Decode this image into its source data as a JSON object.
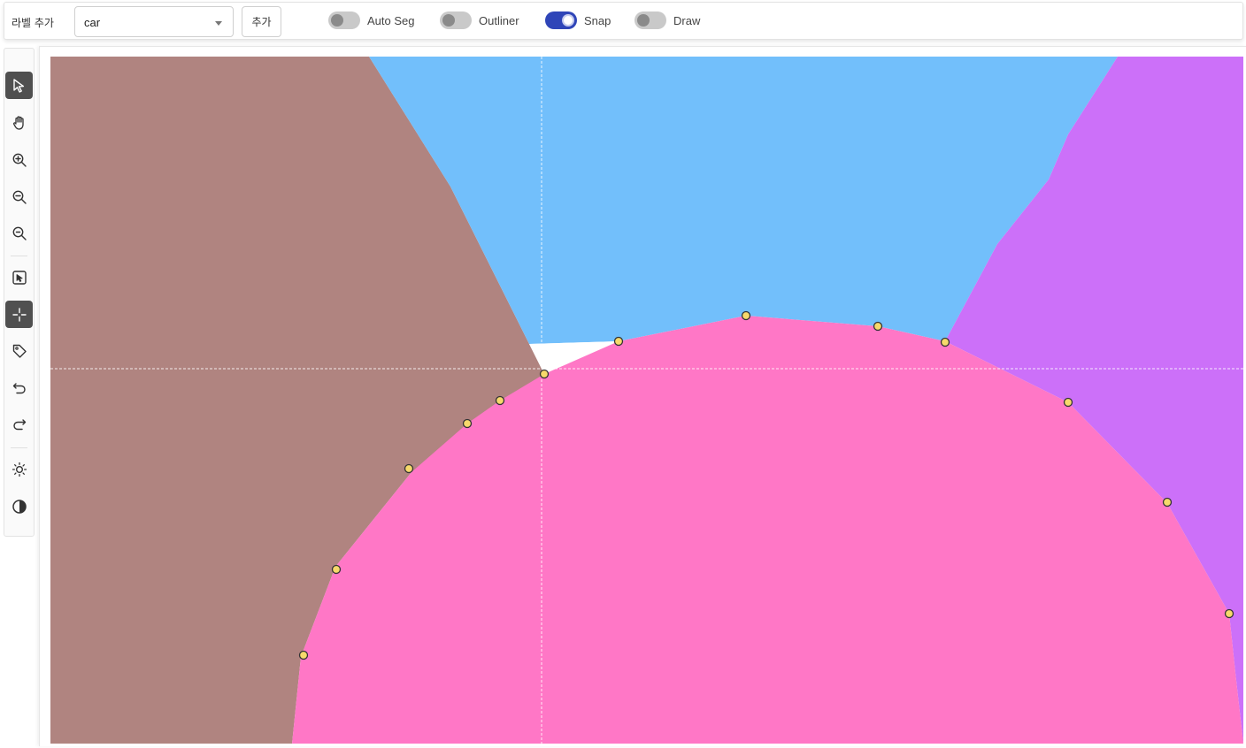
{
  "topbar": {
    "label_title": "라벨 추가",
    "label_select": {
      "value": "car"
    },
    "add_button": "추가",
    "toggles": [
      {
        "label": "Auto Seg",
        "on": false
      },
      {
        "label": "Outliner",
        "on": false
      },
      {
        "label": "Snap",
        "on": true
      },
      {
        "label": "Draw",
        "on": false
      }
    ]
  },
  "toolbar": {
    "tools": [
      {
        "icon": "pointer-icon",
        "active": true
      },
      {
        "icon": "hand-icon",
        "active": false
      },
      {
        "icon": "zoom-in-icon",
        "active": false
      },
      {
        "icon": "zoom-out-icon",
        "active": false
      },
      {
        "icon": "zoom-fit-icon",
        "active": false
      },
      {
        "icon": "select-box-icon",
        "active": false
      },
      {
        "icon": "crosshair-icon",
        "active": true
      },
      {
        "icon": "tag-icon",
        "active": false
      },
      {
        "icon": "undo-icon",
        "active": false
      },
      {
        "icon": "redo-icon",
        "active": false
      },
      {
        "icon": "brightness-icon",
        "active": false
      },
      {
        "icon": "contrast-icon",
        "active": false
      }
    ]
  },
  "canvas": {
    "regions": [
      {
        "name": "brown-region",
        "color": "#b08480"
      },
      {
        "name": "blue-region",
        "color": "#72bffb"
      },
      {
        "name": "purple-region",
        "color": "#cc70f9"
      },
      {
        "name": "pink-polygon",
        "color": "#ff77c6"
      }
    ],
    "vertex_color": "#f7d96b",
    "crosshair_color": "#ffffff"
  }
}
